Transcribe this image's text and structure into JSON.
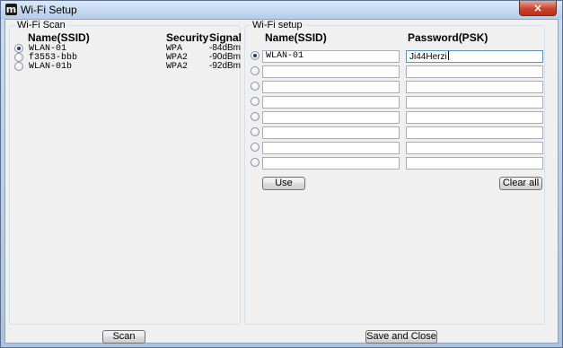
{
  "window": {
    "title": "Wi-Fi Setup",
    "app_icon_glyph": "m",
    "close_glyph": "×"
  },
  "scan": {
    "group_title": "Wi-Fi Scan",
    "headers": {
      "name": "Name(SSID)",
      "security": "Security",
      "signal": "Signal"
    },
    "networks": [
      {
        "ssid": "WLAN-01",
        "security": "WPA",
        "signal": "-84dBm",
        "selected": true
      },
      {
        "ssid": "f3553-bbb",
        "security": "WPA2",
        "signal": "-90dBm",
        "selected": false
      },
      {
        "ssid": "WLAN-01b",
        "security": "WPA2",
        "signal": "-92dBm",
        "selected": false
      }
    ],
    "scan_button": "Scan"
  },
  "setup": {
    "group_title": "Wi-Fi setup",
    "headers": {
      "name": "Name(SSID)",
      "password": "Password(PSK)"
    },
    "entries": [
      {
        "ssid": "WLAN-01",
        "password": "Ji44Herzi",
        "selected": true
      },
      {
        "ssid": "",
        "password": "",
        "selected": false
      },
      {
        "ssid": "",
        "password": "",
        "selected": false
      },
      {
        "ssid": "",
        "password": "",
        "selected": false
      },
      {
        "ssid": "",
        "password": "",
        "selected": false
      },
      {
        "ssid": "",
        "password": "",
        "selected": false
      },
      {
        "ssid": "",
        "password": "",
        "selected": false
      },
      {
        "ssid": "",
        "password": "",
        "selected": false
      }
    ],
    "use_button": "Use",
    "clear_button": "Clear all"
  },
  "footer": {
    "save_button": "Save and Close"
  },
  "colors": {
    "title_bar": "#c2d6ee",
    "close_button": "#c9452c",
    "client_bg": "#f0f0f0"
  }
}
